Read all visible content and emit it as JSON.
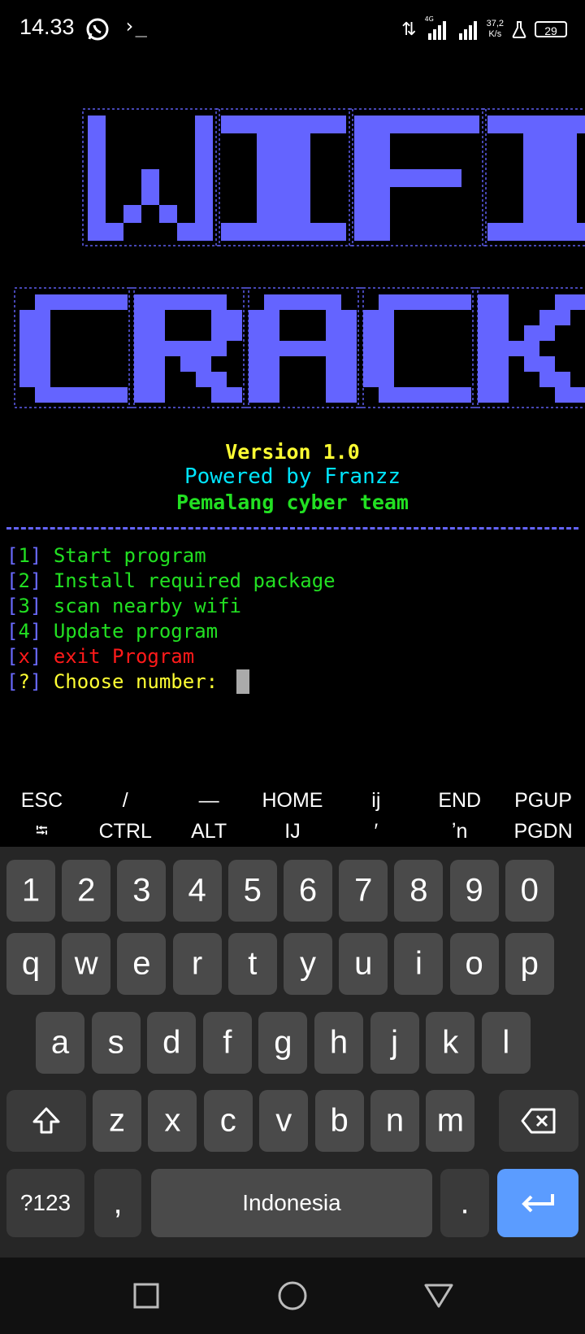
{
  "status_bar": {
    "time": "14.33",
    "terminal_glyph": "›_",
    "net_type": "4G",
    "speed_value": "37,2",
    "speed_unit": "K/s",
    "battery": "29",
    "icons": [
      "whatsapp-icon",
      "terminal-icon",
      "data-arrows-icon",
      "signal-icon",
      "signal-icon",
      "flask-icon",
      "battery-icon"
    ]
  },
  "banner": {
    "line1": "WIFI",
    "line2": "CRACK",
    "color": "#6464ff"
  },
  "title": {
    "version": "Version 1.0",
    "powered": "Powered by Franzz",
    "team": "Pemalang cyber team"
  },
  "menu": {
    "items": [
      {
        "key": "1",
        "label": "Start program"
      },
      {
        "key": "2",
        "label": "Install required package"
      },
      {
        "key": "3",
        "label": "scan nearby wifi"
      },
      {
        "key": "4",
        "label": "Update program"
      },
      {
        "key": "x",
        "label": "exit Program"
      },
      {
        "key": "?",
        "label": "Choose number: "
      }
    ]
  },
  "extra_keys": {
    "row1": [
      "ESC",
      "/",
      "—",
      "HOME",
      "ij",
      "END",
      "PGUP"
    ],
    "row2": [
      "⭾",
      "CTRL",
      "ALT",
      "IJ",
      "′",
      "ʼn",
      "PGDN"
    ]
  },
  "keyboard": {
    "numbers": [
      "1",
      "2",
      "3",
      "4",
      "5",
      "6",
      "7",
      "8",
      "9",
      "0"
    ],
    "row1": [
      "q",
      "w",
      "e",
      "r",
      "t",
      "y",
      "u",
      "i",
      "o",
      "p"
    ],
    "row2": [
      "a",
      "s",
      "d",
      "f",
      "g",
      "h",
      "j",
      "k",
      "l"
    ],
    "row3": [
      "z",
      "x",
      "c",
      "v",
      "b",
      "n",
      "m"
    ],
    "symbols_label": "?123",
    "comma": ",",
    "space_label": "Indonesia",
    "period": ".",
    "enter_color": "#5b9cff"
  },
  "nav": {
    "icons": [
      "recents-icon",
      "home-icon",
      "back-icon"
    ]
  },
  "colors": {
    "background": "#000000",
    "green": "#22e022",
    "red": "#ff1a1a",
    "yellow": "#ffff33",
    "cyan": "#00e5ff",
    "bracket": "#6a6aff"
  }
}
